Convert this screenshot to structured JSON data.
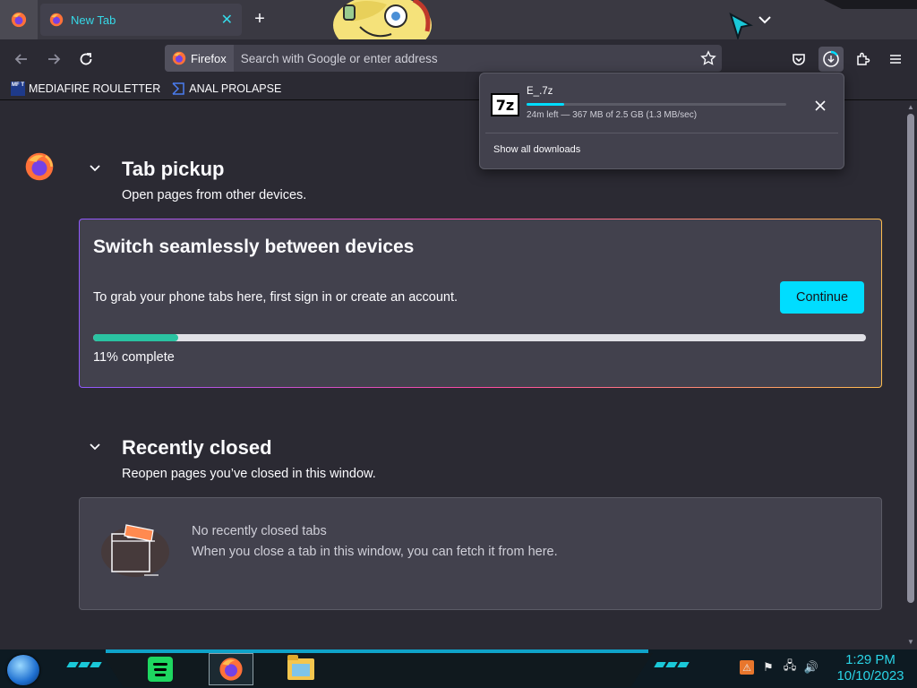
{
  "window": {
    "tab": {
      "title": "New Tab",
      "close": "✕"
    },
    "new_tab": "+"
  },
  "nav": {
    "identity_label": "Firefox",
    "url_placeholder": "Search with Google or enter address"
  },
  "bookmarks": [
    {
      "label": "MEDIAFIRE ROULETTER",
      "icon": "mediafire-icon",
      "badge": "MF T"
    },
    {
      "label": "ANAL PROLAPSE",
      "icon": "bookmark-page-icon"
    }
  ],
  "downloads_panel": {
    "file_name": "E_.7z",
    "file_icon_text": "7z",
    "status": "24m left — 367 MB of 2.5 GB (1.3 MB/sec)",
    "progress_fraction": 0.144,
    "show_all": "Show all downloads"
  },
  "tab_pickup": {
    "title": "Tab pickup",
    "subtitle": "Open pages from other devices.",
    "card_title": "Switch seamlessly between devices",
    "card_text": "To grab your phone tabs here, first sign in or create an account.",
    "continue_label": "Continue",
    "progress_percent": 11,
    "progress_label": "11% complete"
  },
  "recently_closed": {
    "title": "Recently closed",
    "subtitle": "Reopen pages you’ve closed in this window.",
    "empty_title": "No recently closed tabs",
    "empty_desc": "When you close a tab in this window, you can fetch it from here."
  },
  "taskbar": {
    "time": "1:29 PM",
    "date": "10/10/2023"
  },
  "colors": {
    "accent": "#00ddff",
    "progress": "#2ac3a2",
    "tab_text": "#36d9e8",
    "clock": "#2ad4e6"
  }
}
